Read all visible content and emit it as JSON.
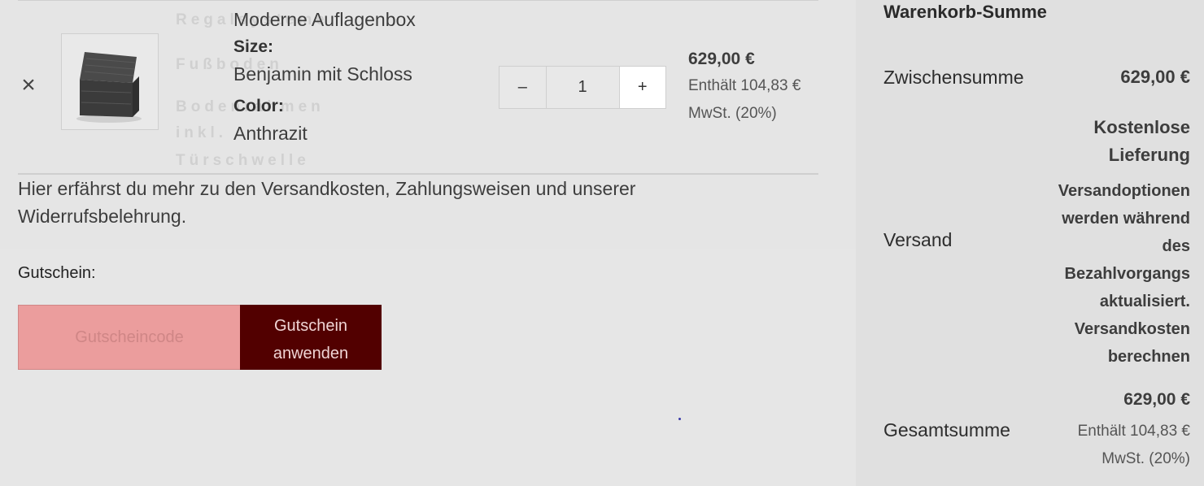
{
  "cart": {
    "remove_symbol": "×",
    "ghost_menu": [
      "Regalsysteme",
      "Fußboden",
      "Bodenrahmen",
      "inkl.",
      "Türschwelle"
    ],
    "item": {
      "name": "Moderne Auflagenbox",
      "size_label": "Size:",
      "size_value": "Benjamin mit Schloss",
      "color_label": "Color:",
      "color_value": "Anthrazit",
      "price": "629,00 €",
      "tax_line1": "Enthält 104,83 €",
      "tax_line2": "MwSt. (20%)"
    },
    "quantity": {
      "minus": "–",
      "value": "1",
      "plus": "+"
    },
    "info_text": "Hier erfährst du mehr zu den Versandkosten, Zahlungsweisen und unserer Widerrufsbelehrung."
  },
  "coupon": {
    "label": "Gutschein:",
    "placeholder": "Gutscheincode",
    "button_line1": "Gutschein",
    "button_line2": "anwenden"
  },
  "summary": {
    "title": "Warenkorb-Summe",
    "subtotal_label": "Zwischensumme",
    "subtotal_value": "629,00 €",
    "shipping_label": "Versand",
    "shipping_free_line1": "Kostenlose",
    "shipping_free_line2": "Lieferung",
    "shipping_note_lines": [
      "Versandoptionen",
      "werden während",
      "des",
      "Bezahlvorgangs",
      "aktualisiert."
    ],
    "shipping_calc_line1": "Versandkosten",
    "shipping_calc_line2": "berechnen",
    "total_label": "Gesamtsumme",
    "total_value": "629,00 €",
    "total_tax_line1": "Enthält 104,83 €",
    "total_tax_line2": "MwSt. (20%)"
  },
  "colors": {
    "coupon_input_bg": "#eb9d9d",
    "coupon_button_bg": "#520000",
    "summary_bg": "#e0e0e0"
  }
}
